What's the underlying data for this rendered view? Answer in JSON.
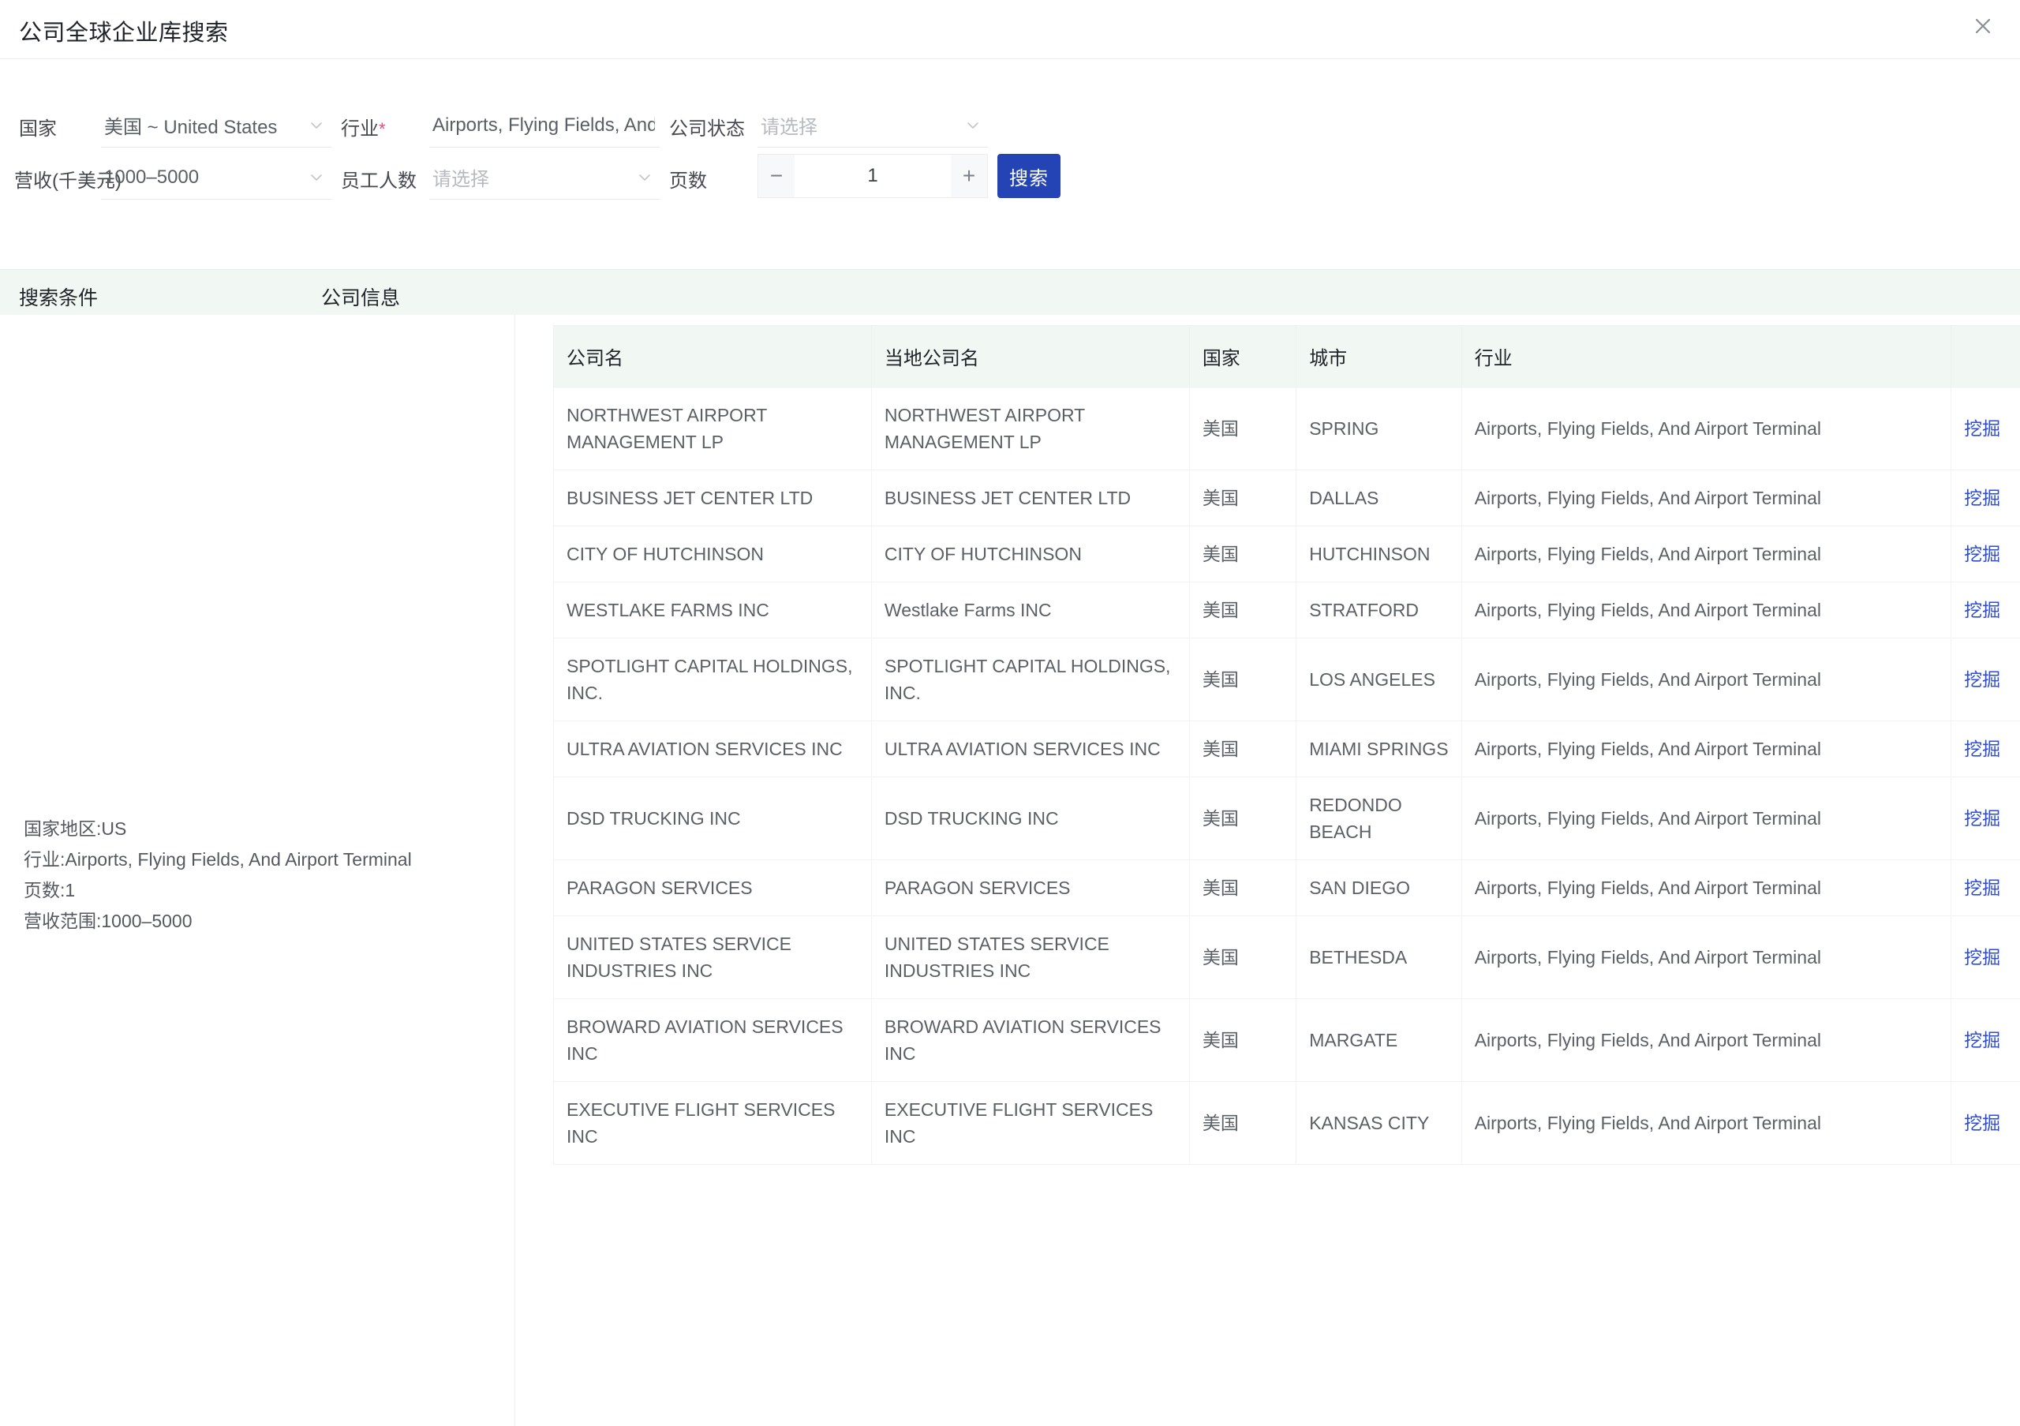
{
  "window": {
    "title": "公司全球企业库搜索",
    "close_icon": "close-icon"
  },
  "form": {
    "country": {
      "label": "国家",
      "value": "美国 ~ United States",
      "icon": "chevron-down-icon"
    },
    "industry": {
      "label": "行业",
      "required_mark": "*",
      "value": "Airports, Flying Fields, And Airport Ter"
    },
    "company_status": {
      "label": "公司状态",
      "placeholder": "请选择",
      "icon": "chevron-down-icon"
    },
    "revenue": {
      "label": "营收(千美元)",
      "value": "1000–5000",
      "icon": "chevron-down-icon"
    },
    "employees": {
      "label": "员工人数",
      "placeholder": "请选择",
      "icon": "chevron-down-icon"
    },
    "pages": {
      "label": "页数",
      "value": "1",
      "minus": "−",
      "plus": "+"
    },
    "search_button": "搜索"
  },
  "sections": {
    "criteria_title": "搜索条件",
    "results_title": "公司信息"
  },
  "criteria_summary": [
    "国家地区:US",
    "行业:Airports, Flying Fields, And Airport Terminal",
    "页数:1",
    "营收范围:1000–5000"
  ],
  "table": {
    "columns": [
      "公司名",
      "当地公司名",
      "国家",
      "城市",
      "行业",
      ""
    ],
    "action_label": "挖掘",
    "rows": [
      {
        "name": "NORTHWEST AIRPORT MANAGEMENT LP",
        "local_name": "NORTHWEST AIRPORT MANAGEMENT LP",
        "country": "美国",
        "city": "SPRING",
        "industry": "Airports, Flying Fields, And Airport Terminal"
      },
      {
        "name": "BUSINESS JET CENTER LTD",
        "local_name": "BUSINESS JET CENTER LTD",
        "country": "美国",
        "city": "DALLAS",
        "industry": "Airports, Flying Fields, And Airport Terminal"
      },
      {
        "name": "CITY OF HUTCHINSON",
        "local_name": "CITY OF HUTCHINSON",
        "country": "美国",
        "city": "HUTCHINSON",
        "industry": "Airports, Flying Fields, And Airport Terminal"
      },
      {
        "name": "WESTLAKE FARMS INC",
        "local_name": "Westlake Farms INC",
        "country": "美国",
        "city": "STRATFORD",
        "industry": "Airports, Flying Fields, And Airport Terminal"
      },
      {
        "name": "SPOTLIGHT CAPITAL HOLDINGS, INC.",
        "local_name": "SPOTLIGHT CAPITAL HOLDINGS, INC.",
        "country": "美国",
        "city": "LOS ANGELES",
        "industry": "Airports, Flying Fields, And Airport Terminal"
      },
      {
        "name": "ULTRA AVIATION SERVICES INC",
        "local_name": "ULTRA AVIATION SERVICES INC",
        "country": "美国",
        "city": "MIAMI SPRINGS",
        "industry": "Airports, Flying Fields, And Airport Terminal"
      },
      {
        "name": "DSD TRUCKING INC",
        "local_name": "DSD TRUCKING INC",
        "country": "美国",
        "city": "REDONDO BEACH",
        "industry": "Airports, Flying Fields, And Airport Terminal"
      },
      {
        "name": "PARAGON SERVICES",
        "local_name": "PARAGON SERVICES",
        "country": "美国",
        "city": "SAN DIEGO",
        "industry": "Airports, Flying Fields, And Airport Terminal"
      },
      {
        "name": "UNITED STATES SERVICE INDUSTRIES INC",
        "local_name": "UNITED STATES SERVICE INDUSTRIES INC",
        "country": "美国",
        "city": "BETHESDA",
        "industry": "Airports, Flying Fields, And Airport Terminal"
      },
      {
        "name": "BROWARD AVIATION SERVICES INC",
        "local_name": "BROWARD AVIATION SERVICES INC",
        "country": "美国",
        "city": "MARGATE",
        "industry": "Airports, Flying Fields, And Airport Terminal"
      },
      {
        "name": "EXECUTIVE FLIGHT SERVICES INC",
        "local_name": "EXECUTIVE FLIGHT SERVICES INC",
        "country": "美国",
        "city": "KANSAS CITY",
        "industry": "Airports, Flying Fields, And Airport Terminal"
      }
    ]
  },
  "colors": {
    "accent": "#2443b5",
    "link": "#2c4bd6",
    "band": "#f1f7f2",
    "required": "#e8467c"
  }
}
